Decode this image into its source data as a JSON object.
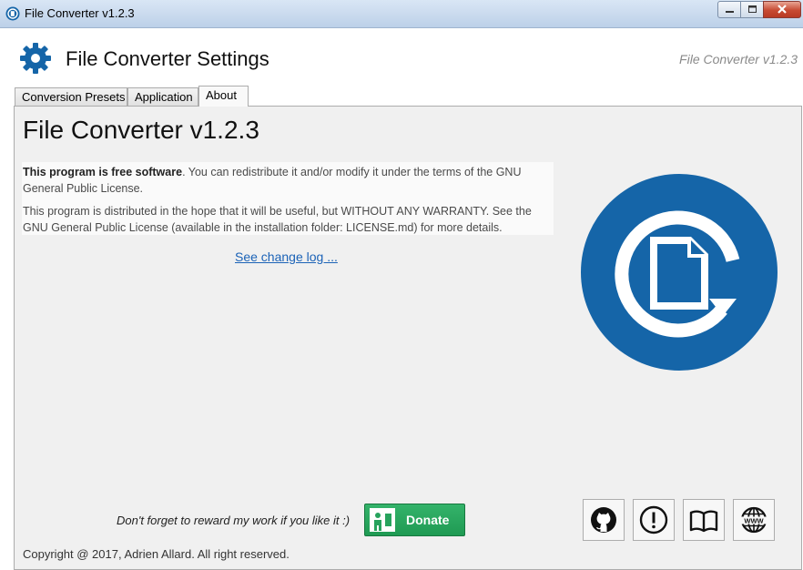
{
  "window": {
    "title": "File Converter v1.2.3",
    "icons": {
      "app": "file-converter-icon",
      "minimize": "minimize-icon",
      "maximize": "maximize-icon",
      "close": "close-icon"
    }
  },
  "header": {
    "title": "File Converter Settings",
    "version": "File Converter v1.2.3",
    "icon": "gear-icon"
  },
  "tabs": [
    {
      "label": "Conversion Presets",
      "selected": false
    },
    {
      "label": "Application",
      "selected": false
    },
    {
      "label": "About",
      "selected": true
    }
  ],
  "about": {
    "title": "File Converter v1.2.3",
    "license_bold": "This program is free software",
    "license_rest": ". You can redistribute it and/or modify it under the terms of the GNU General Public License.",
    "warranty": "This program is distributed in the hope that it will be useful, but WITHOUT ANY WARRANTY. See the GNU General Public License (available in the installation folder: LICENSE.md) for more details.",
    "changelog_link": "See change log ...",
    "logo": "file-converter-logo"
  },
  "footer": {
    "reward_text": "Don't forget to reward my work if you like it :)",
    "donate_label": "Donate",
    "link_buttons": [
      "github-icon",
      "issue-icon",
      "documentation-icon",
      "website-icon"
    ],
    "copyright": "Copyright @ 2017, Adrien Allard. All right reserved."
  },
  "colors": {
    "accent": "#1565a8",
    "donate": "#27a35d",
    "link": "#1c63b7"
  }
}
